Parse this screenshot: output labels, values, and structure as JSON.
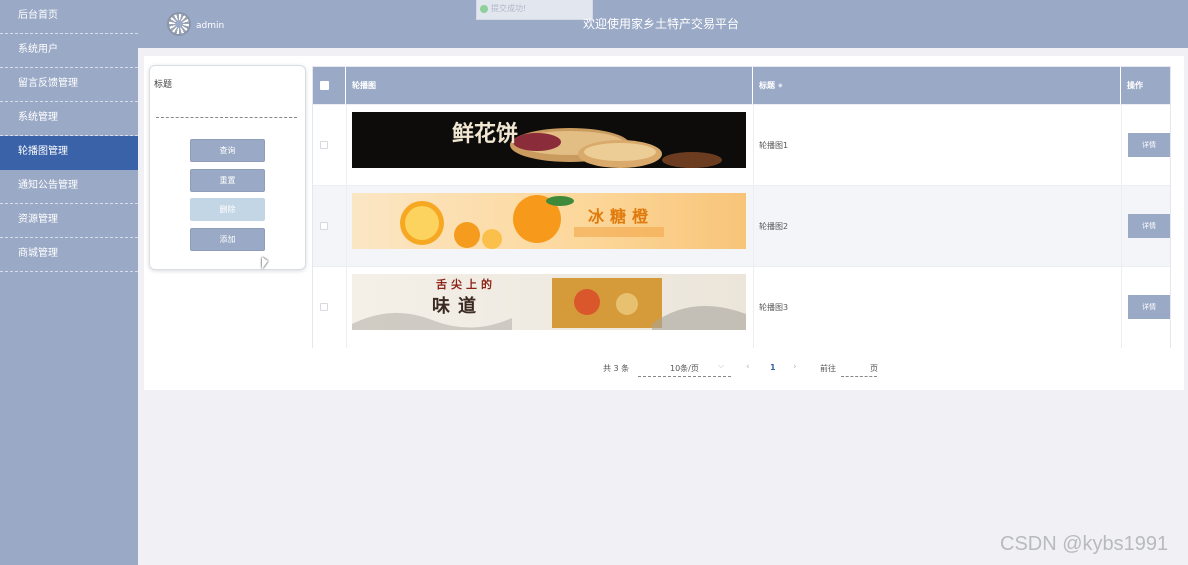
{
  "sidebar": {
    "items": [
      {
        "label": "后台首页"
      },
      {
        "label": "系统用户"
      },
      {
        "label": "留言反馈管理"
      },
      {
        "label": "系统管理"
      },
      {
        "label": "轮播图管理"
      },
      {
        "label": "通知公告管理"
      },
      {
        "label": "资源管理"
      },
      {
        "label": "商城管理"
      }
    ],
    "active_index": 4
  },
  "header": {
    "username": "admin",
    "title": "欢迎使用家乡土特产交易平台",
    "toast": "提交成功!"
  },
  "search": {
    "field_label": "标题",
    "input_value": "",
    "buttons": {
      "query": "查询",
      "reset": "重置",
      "delete": "删除",
      "add": "添加"
    }
  },
  "table": {
    "columns": {
      "image": "轮播图",
      "title": "标题",
      "action": "操作"
    },
    "rows": [
      {
        "title": "轮播图1",
        "action": "详情",
        "banner": {
          "text1": "鲜花饼",
          "text2": ""
        }
      },
      {
        "title": "轮播图2",
        "action": "详情",
        "banner": {
          "text1": "冰糖橙",
          "text2": ""
        }
      },
      {
        "title": "轮播图3",
        "action": "详情",
        "banner": {
          "text1": "舌尖上的",
          "text2": "味道"
        }
      }
    ]
  },
  "pagination": {
    "total": "共 3 条",
    "page_size": "10条/页",
    "current": "1",
    "goto_label": "前往",
    "page_suffix": "页",
    "goto_value": ""
  },
  "watermark": "CSDN @kybs1991",
  "colors": {
    "sidebar_bg": "#9aa9c6",
    "active_menu": "#3a62a8",
    "page_bg": "#f0f0f5"
  }
}
